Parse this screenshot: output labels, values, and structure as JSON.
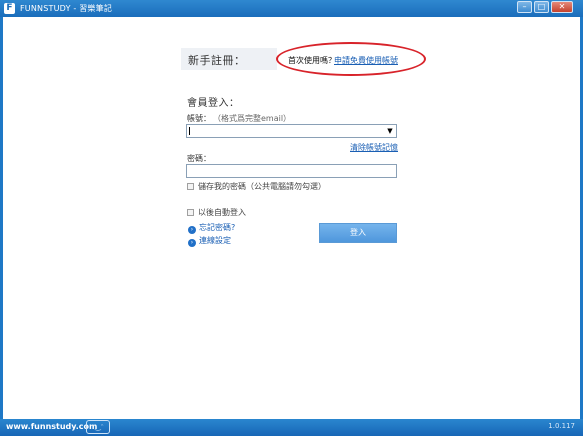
{
  "titlebar": {
    "title": "FUNNSTUDY - 習樂筆記",
    "app_icon_glyph": "F",
    "minimize_glyph": "–",
    "maximize_glyph": "□",
    "close_glyph": "✕"
  },
  "register": {
    "label": "新手註冊：",
    "first_use_text": "首次使用嗎？",
    "apply_link": "申請免費使用帳號",
    "highlight_color": "#d8232a"
  },
  "login": {
    "heading": "會員登入：",
    "account_label": "帳號：",
    "account_hint": "（格式爲完整email）",
    "account_value": "",
    "clear_link": "清除帳號記憶",
    "password_label": "密碼：",
    "password_value": "",
    "remember_label": "儲存我的密碼（公共電腦請勿勾選）",
    "remember_checked": false,
    "autologin_label": "以後自動登入",
    "autologin_checked": false,
    "forgot_link": "忘記密碼?",
    "connection_link": "連線設定",
    "login_button": "登入"
  },
  "footer": {
    "site": "www.funnstudy.com",
    "chat_icon": "chat-icon",
    "version": "1.0.117"
  },
  "colors": {
    "titlebar": "#1a6dbb",
    "link": "#1a5fb4",
    "button": "#5ea4e4"
  }
}
